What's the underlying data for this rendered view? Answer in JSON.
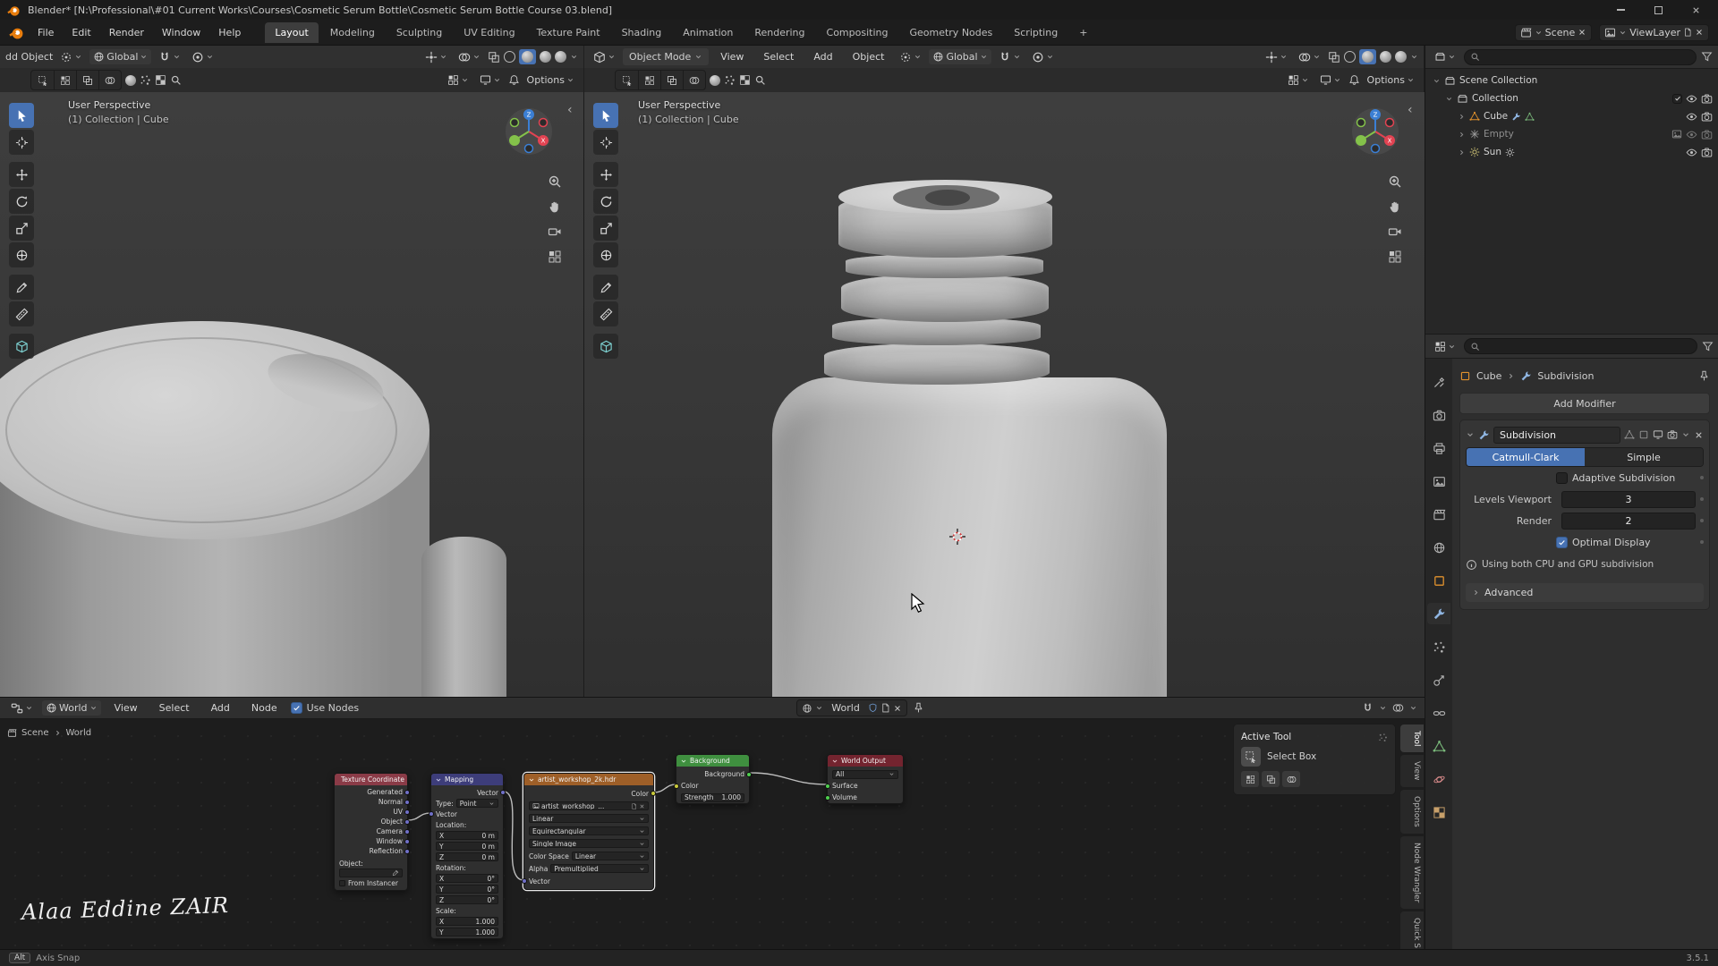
{
  "window": {
    "title": "Blender* [N:\\Professional\\#01 Current Works\\Courses\\Cosmetic Serum Bottle\\Cosmetic Serum Bottle Course 03.blend]"
  },
  "topbar": {
    "menus": [
      "File",
      "Edit",
      "Render",
      "Window",
      "Help"
    ],
    "workspaces": [
      "Layout",
      "Modeling",
      "Sculpting",
      "UV Editing",
      "Texture Paint",
      "Shading",
      "Animation",
      "Rendering",
      "Compositing",
      "Geometry Nodes",
      "Scripting"
    ],
    "add_workspace": "+",
    "scene_name": "Scene",
    "viewlayer_name": "ViewLayer"
  },
  "viewport_left": {
    "clipped_menu": "dd Object",
    "orientation": "Global",
    "options_label": "Options",
    "view_label": "User Perspective",
    "context_label": "(1) Collection | Cube"
  },
  "viewport_right": {
    "mode": "Object Mode",
    "menus": [
      "View",
      "Select",
      "Add",
      "Object"
    ],
    "orientation": "Global",
    "options_label": "Options",
    "view_label": "User Perspective",
    "context_label": "(1) Collection | Cube"
  },
  "outliner": {
    "rows": [
      {
        "label": "Scene Collection"
      },
      {
        "label": "Collection"
      },
      {
        "label": "Cube"
      },
      {
        "label": "Empty"
      },
      {
        "label": "Sun"
      }
    ]
  },
  "properties": {
    "tab_icons": [
      "tool",
      "render",
      "output",
      "view-layer",
      "scene",
      "world",
      "object",
      "modifiers",
      "particles",
      "physics",
      "constraints",
      "object-data",
      "material",
      "texture"
    ],
    "breadcrumb_object": "Cube",
    "breadcrumb_modifier": "Subdivision",
    "add_modifier_label": "Add Modifier",
    "modifier": {
      "name": "Subdivision",
      "type_catmull": "Catmull-Clark",
      "type_simple": "Simple",
      "adaptive_label": "Adaptive Subdivision",
      "levels_label": "Levels Viewport",
      "levels_value": "3",
      "render_label": "Render",
      "render_value": "2",
      "optimal_label": "Optimal Display",
      "info_text": "Using both CPU and GPU subdivision",
      "advanced_label": "Advanced"
    }
  },
  "shader_editor": {
    "type_value": "World",
    "menus": [
      "View",
      "Select",
      "Add",
      "Node"
    ],
    "use_nodes_label": "Use Nodes",
    "datablock_name": "World",
    "path_scene": "Scene",
    "path_world": "World",
    "sidebar_tabs": [
      "Tool",
      "View",
      "Options",
      "Node Wrangler",
      "Quick S"
    ],
    "active_tool_title": "Active Tool",
    "active_tool_name": "Select Box",
    "nodes": {
      "texture_coordinate": {
        "title": "Texture Coordinate",
        "outputs": [
          "Generated",
          "Normal",
          "UV",
          "Object",
          "Camera",
          "Window",
          "Reflection"
        ],
        "object_label": "Object:",
        "from_instancer_label": "From Instancer"
      },
      "mapping": {
        "title": "Mapping",
        "output": "Vector",
        "type_label": "Type:",
        "type_value": "Point",
        "input": "Vector",
        "location_label": "Location:",
        "rotation_label": "Rotation:",
        "scale_label": "Scale:",
        "axes": [
          "X",
          "Y",
          "Z"
        ],
        "location": [
          "0 m",
          "0 m",
          "0 m"
        ],
        "rotation": [
          "0°",
          "0°",
          "0°"
        ],
        "scale": [
          "1.000",
          "1.000"
        ]
      },
      "environment_texture": {
        "title": "artist_workshop_2k.hdr",
        "output": "Color",
        "image_name": "artist_workshop_...",
        "interpolation": "Linear",
        "projection": "Equirectangular",
        "source": "Single Image",
        "color_space_label": "Color Space",
        "color_space_value": "Linear",
        "alpha_label": "Alpha",
        "alpha_value": "Premultiplied",
        "input": "Vector"
      },
      "background": {
        "title": "Background",
        "output": "Background",
        "color_label": "Color",
        "strength_label": "Strength",
        "strength_value": "1.000"
      },
      "world_output": {
        "title": "World Output",
        "target_value": "All",
        "inputs": [
          "Surface",
          "Volume"
        ]
      }
    }
  },
  "status_bar": {
    "key_hint": "Alt",
    "action_hint": "Axis Snap",
    "version": "3.5.1"
  },
  "watermark": "Alaa Eddine ZAIR",
  "colors": {
    "accent": "#4772b3",
    "object_orange": "#e0912d",
    "axis_x": "#e24352",
    "axis_y": "#84c24a",
    "axis_z": "#3b7fd4"
  }
}
